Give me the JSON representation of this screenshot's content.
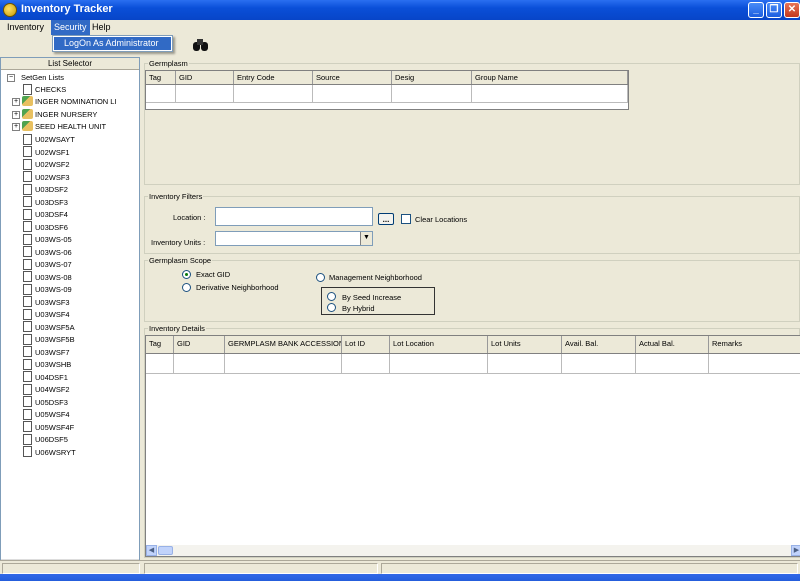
{
  "window": {
    "title": "Inventory Tracker"
  },
  "menu": {
    "items": [
      "Inventory",
      "Security",
      "Help"
    ],
    "active": "Security"
  },
  "security_menu": {
    "items": [
      "LogOn As Administrator"
    ]
  },
  "left_panel": {
    "header": "List Selector",
    "root": "SetGen Lists",
    "folders": [
      "CHECKS",
      "INGER NOMINATION LI",
      "INGER NURSERY",
      "SEED HEALTH UNIT"
    ],
    "items": [
      "U02WSAYT",
      "U02WSF1",
      "U02WSF2",
      "U02WSF3",
      "U03DSF2",
      "U03DSF3",
      "U03DSF4",
      "U03DSF6",
      "U03WS-05",
      "U03WS-06",
      "U03WS-07",
      "U03WS-08",
      "U03WS-09",
      "U03WSF3",
      "U03WSF4",
      "U03WSF5A",
      "U03WSF5B",
      "U03WSF7",
      "U03WSHB",
      "U04DSF1",
      "U04WSF2",
      "U05DSF3",
      "U05WSF4",
      "U05WSF4F",
      "U06DSF5",
      "U06WSRYT"
    ]
  },
  "germplasm": {
    "label": "Germplasm",
    "columns": [
      "Tag",
      "GID",
      "Entry Code",
      "Source",
      "Desig",
      "Group Name"
    ]
  },
  "filters": {
    "label": "Inventory Filters",
    "location_label": "Location :",
    "browse_label": "...",
    "clear_label": "Clear Locations",
    "units_label": "Inventory Units :"
  },
  "scope": {
    "label": "Germplasm Scope",
    "exact": "Exact GID",
    "derivative": "Derivative Neighborhood",
    "management": "Management Neighborhood",
    "seed_increase": "By Seed Increase",
    "hybrid": "By Hybrid"
  },
  "details": {
    "label": "Inventory Details",
    "columns": [
      "Tag",
      "GID",
      "GERMPLASM BANK ACCESSION",
      "Lot ID",
      "Lot Location",
      "Lot Units",
      "Avail. Bal.",
      "Actual Bal.",
      "Remarks"
    ]
  }
}
